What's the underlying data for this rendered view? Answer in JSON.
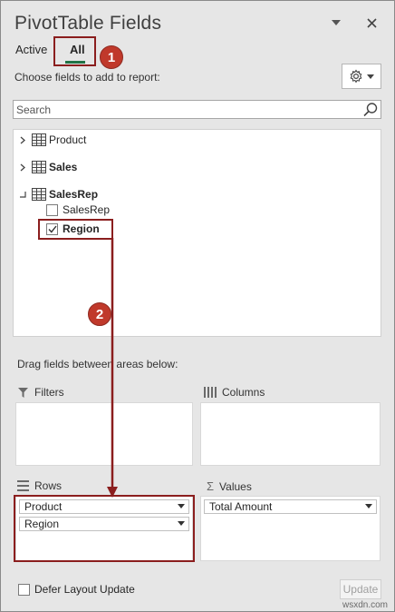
{
  "panel": {
    "title": "PivotTable Fields",
    "tabs": [
      {
        "label": "Active",
        "selected": false
      },
      {
        "label": "All",
        "selected": true
      }
    ],
    "choose_text": "Choose fields to add to report:",
    "search_placeholder": "Search"
  },
  "fields": [
    {
      "label": "Product",
      "type": "table",
      "expanded": false,
      "bold": false
    },
    {
      "label": "Sales",
      "type": "table",
      "expanded": false,
      "bold": true
    },
    {
      "label": "SalesRep",
      "type": "table",
      "expanded": true,
      "bold": true
    },
    {
      "label": "SalesRep",
      "type": "field",
      "checked": false,
      "bold": false
    },
    {
      "label": "Region",
      "type": "field",
      "checked": true,
      "bold": true
    }
  ],
  "areas": {
    "drag_label": "Drag fields between areas below:",
    "filters": {
      "title": "Filters",
      "items": []
    },
    "columns": {
      "title": "Columns",
      "items": []
    },
    "rows": {
      "title": "Rows",
      "items": [
        "Product",
        "Region"
      ]
    },
    "values": {
      "title": "Values",
      "items": [
        "Total Amount"
      ]
    }
  },
  "footer": {
    "defer_label": "Defer Layout Update",
    "defer_checked": false,
    "update_label": "Update"
  },
  "annotations": {
    "callout_1": "1",
    "callout_2": "2"
  },
  "watermark": "wsxdn.com",
  "colors": {
    "accent": "#217346",
    "annotation_red": "#c0392b",
    "annotation_box": "#8b1e1e"
  }
}
